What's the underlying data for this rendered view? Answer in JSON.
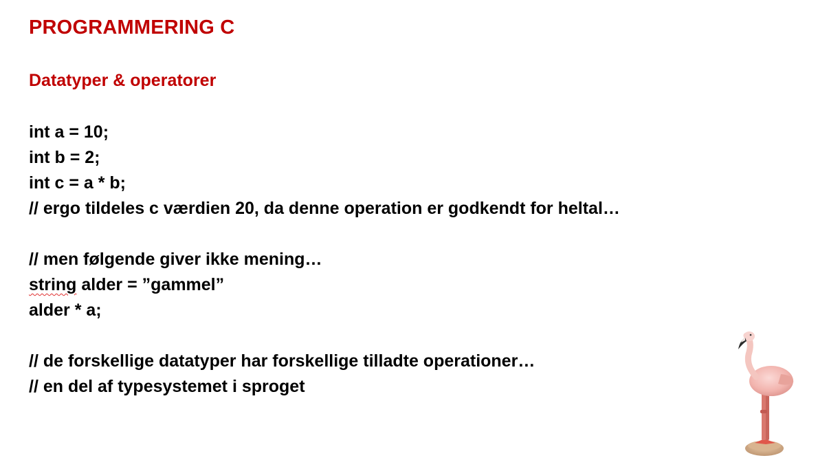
{
  "slide": {
    "title": "PROGRAMMERING C",
    "subtitle": "Datatyper & operatorer",
    "code": {
      "line1": "int a = 10;",
      "line2": "int b = 2;",
      "line3": "int c = a * b;",
      "line4": "// ergo tildeles c værdien 20, da denne operation er godkendt for heltal…",
      "line5": "// men følgende giver ikke mening…",
      "line6_keyword": "string",
      "line6_rest": " alder = ”gammel”",
      "line7": "alder * a;",
      "line8": "// de forskellige datatyper har forskellige tilladte operationer…",
      "line9": "// en del af typesystemet i sproget"
    },
    "colors": {
      "heading": "#c00000",
      "body_text": "#000000",
      "spellcheck_underline": "#e03030"
    },
    "decoration": {
      "icon": "flamingo-figurine-icon"
    }
  }
}
